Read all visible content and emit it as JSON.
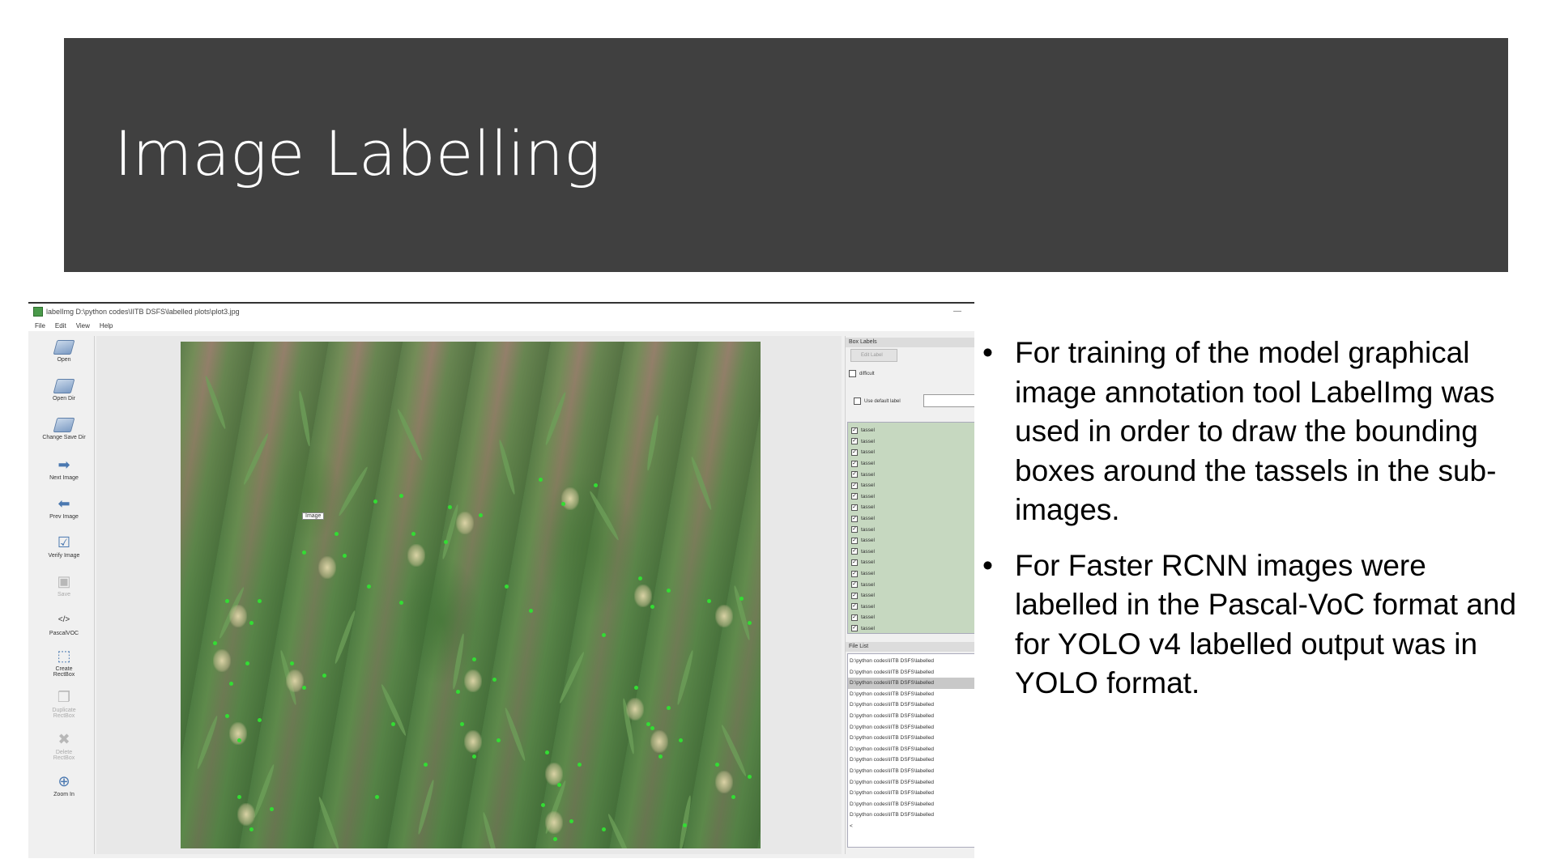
{
  "slide": {
    "title": "Image Labelling",
    "bullets": [
      "For training of the model graphical image annotation tool LabelImg was used in order to draw the bounding boxes around the tassels in the sub-images.",
      "For Faster RCNN images were labelled in the Pascal-VoC format and for YOLO v4 labelled output was in YOLO format."
    ]
  },
  "app": {
    "window_title": "labelImg D:\\python codes\\IITB DSFS\\labelled plots\\plot3.jpg",
    "minimize_glyph": "—",
    "menu": [
      "File",
      "Edit",
      "View",
      "Help"
    ],
    "toolbar": [
      {
        "label": "Open",
        "icon": "folder-icon",
        "enabled": true
      },
      {
        "label": "Open Dir",
        "icon": "folder-icon",
        "enabled": true
      },
      {
        "label": "Change Save Dir",
        "icon": "folder-icon",
        "enabled": true
      },
      {
        "label": "Next Image",
        "icon": "arrow-right-icon",
        "enabled": true
      },
      {
        "label": "Prev Image",
        "icon": "arrow-left-icon",
        "enabled": true
      },
      {
        "label": "Verify Image",
        "icon": "checkbox-icon",
        "enabled": true
      },
      {
        "label": "Save",
        "icon": "save-icon",
        "enabled": false
      },
      {
        "label": "PascalVOC",
        "icon": "code-icon",
        "enabled": true
      },
      {
        "label": "Create\\nRectBox",
        "icon": "create-rect-icon",
        "enabled": true
      },
      {
        "label": "Duplicate\\nRectBox",
        "icon": "duplicate-icon",
        "enabled": false
      },
      {
        "label": "Delete\\nRectBox",
        "icon": "delete-icon",
        "enabled": false
      },
      {
        "label": "Zoom In",
        "icon": "zoom-in-icon",
        "enabled": true
      }
    ],
    "canvas_tooltip": "Image",
    "box_labels": {
      "header": "Box Labels",
      "edit_label": "Edit Label",
      "difficult": "difficult",
      "use_default_label": "Use default label",
      "labels": [
        "tassel",
        "tassel",
        "tassel",
        "tassel",
        "tassel",
        "tassel",
        "tassel",
        "tassel",
        "tassel",
        "tassel",
        "tassel",
        "tassel",
        "tassel",
        "tassel",
        "tassel",
        "tassel",
        "tassel",
        "tassel",
        "tassel"
      ]
    },
    "file_list": {
      "header": "File List",
      "selected_index": 2,
      "files": [
        "D:\\python codes\\IITB DSFS\\labelled",
        "D:\\python codes\\IITB DSFS\\labelled",
        "D:\\python codes\\IITB DSFS\\labelled",
        "D:\\python codes\\IITB DSFS\\labelled",
        "D:\\python codes\\IITB DSFS\\labelled",
        "D:\\python codes\\IITB DSFS\\labelled",
        "D:\\python codes\\IITB DSFS\\labelled",
        "D:\\python codes\\IITB DSFS\\labelled",
        "D:\\python codes\\IITB DSFS\\labelled",
        "D:\\python codes\\IITB DSFS\\labelled",
        "D:\\python codes\\IITB DSFS\\labelled",
        "D:\\python codes\\IITB DSFS\\labelled",
        "D:\\python codes\\IITB DSFS\\labelled",
        "D:\\python codes\\IITB DSFS\\labelled",
        "D:\\python codes\\IITB DSFS\\labelled"
      ],
      "scroll_glyph": "<"
    },
    "colors": {
      "banner": "#404040",
      "label_list_bg": "#c6d8c0",
      "keypoint": "#33dd33"
    }
  }
}
